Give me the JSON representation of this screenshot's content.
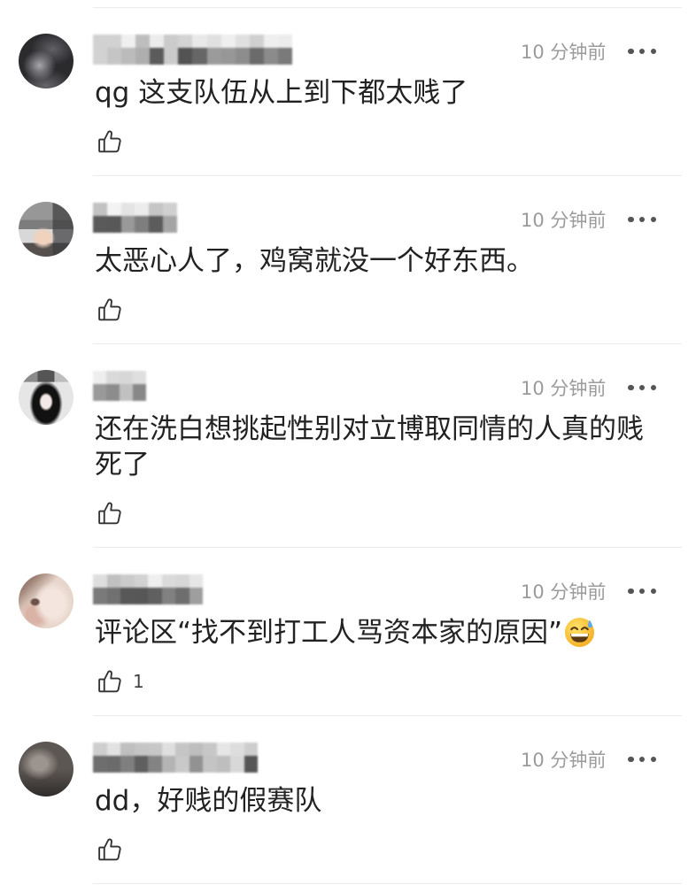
{
  "colors": {
    "text": "#222222",
    "meta": "#9b9b9b",
    "divider": "#ebebeb",
    "icon": "#333333",
    "dots": "#555555"
  },
  "icons": {
    "more": "more-dots-icon",
    "like": "thumb-up-icon"
  },
  "comments": [
    {
      "time": "10 分钟前",
      "text": "qg 这支队伍从上到下都太贱了"
    },
    {
      "time": "10 分钟前",
      "text": "太恶心人了，鸡窝就没一个好东西。"
    },
    {
      "time": "10 分钟前",
      "text": "还在洗白想挑起性别对立博取同情的人真的贱死了"
    },
    {
      "time": "10 分钟前",
      "text": "评论区“找不到打工人骂资本家的原因”",
      "emoji": "grinning-face-with-sweat-emoji",
      "like_count": "1"
    },
    {
      "time": "10 分钟前",
      "text": "dd，好贱的假赛队"
    }
  ]
}
